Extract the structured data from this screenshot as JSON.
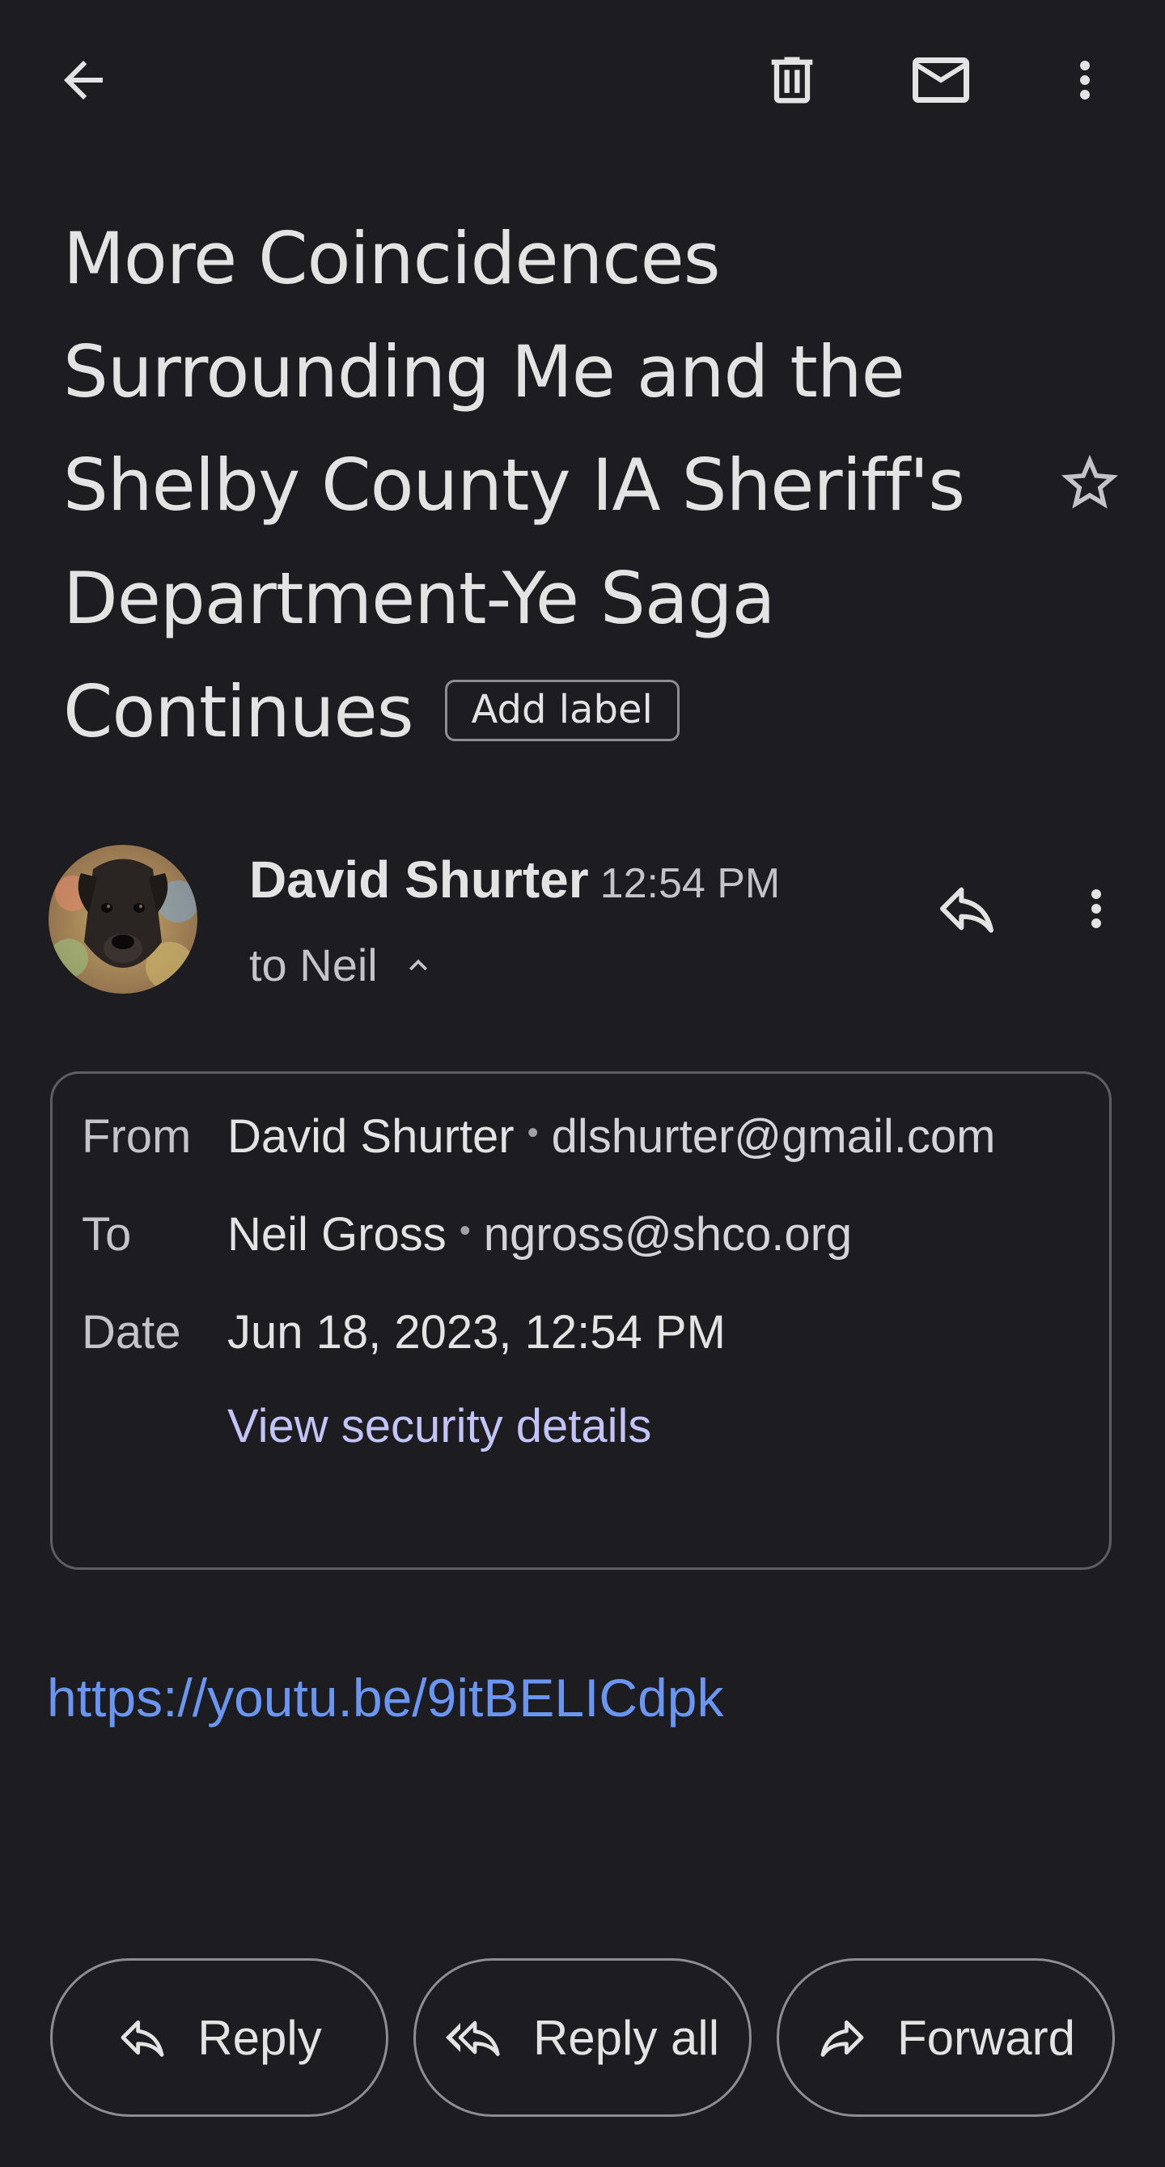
{
  "topbar": {
    "back_icon": "arrow-back-icon",
    "delete_icon": "trash-icon",
    "mark_unread_icon": "mail-icon",
    "more_icon": "more-vertical-icon"
  },
  "email": {
    "subject": "More Coincidences Surrounding Me and the Shelby County IA Sheriff's Department-Ye Saga Continues",
    "add_label": "Add label",
    "star_icon": "star-outline-icon"
  },
  "sender": {
    "name": "David Shurter",
    "time": "12:54 PM",
    "to_line": "to Neil",
    "reply_icon": "reply-icon",
    "more_icon": "more-vertical-icon"
  },
  "details": {
    "from_label": "From",
    "from_name": "David Shurter",
    "from_email": "dlshurter@gmail.com",
    "to_label": "To",
    "to_name": "Neil Gross",
    "to_email": "ngross@shco.org",
    "date_label": "Date",
    "date_value": "Jun 18, 2023, 12:54 PM",
    "security_link": "View security details",
    "separator": "•"
  },
  "body": {
    "link": "https://youtu.be/9itBELICdpk"
  },
  "actions": {
    "reply": "Reply",
    "reply_all": "Reply all",
    "forward": "Forward"
  },
  "colors": {
    "background": "#1c1c21",
    "text": "#e3e3e3",
    "link": "#6a96f2",
    "security_link": "#c2c3f7",
    "border": "#8e8e92"
  }
}
